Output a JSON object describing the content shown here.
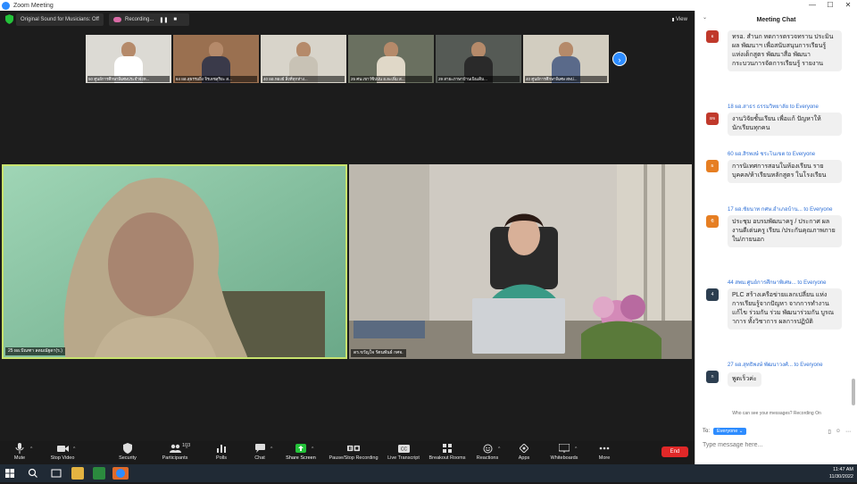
{
  "window": {
    "title": "Zoom Meeting",
    "controls": [
      "—",
      "☐",
      "✕"
    ]
  },
  "topbar": {
    "sound_label": "Original Sound for Musicians: Off",
    "recording_label": "Recording...",
    "pause_glyph": "❚❚",
    "stop_glyph": "■",
    "view_label": "View"
  },
  "thumbnails": [
    {
      "name": "50 ศูนย์การศึกษาพิเศษประจำจังห...",
      "bg": "#dcdad4",
      "shirt": "#ffffff"
    },
    {
      "name": "64 ผอ.สุธรรมยิ่ง จิรเดชสุริยะ ส...",
      "bg": "#9a7050",
      "shirt": "#3a3a4a"
    },
    {
      "name": "40 ผอ.ทองย์ สิ่งที่ทุกห่าง...",
      "bg": "#d8d4ca",
      "shirt": "#c8c2b5"
    },
    {
      "name": "25 ศน.เขาว์ซิปปน อ.ละเพิ่ม ส...",
      "bg": "#6a7060",
      "shirt": "#e0d8c8"
    },
    {
      "name": "29 สายะภาษาบ้านเนินเดิม...",
      "bg": "#555a55",
      "shirt": "#2a2a2a"
    },
    {
      "name": "40 ศูนย์การศึกษาพิเศษ สพป...",
      "bg": "#d2cdc0",
      "shirt": "#5a6a8a"
    }
  ],
  "next_glyph": "›",
  "videos": {
    "left_label": "25 ผอ.ปัณฑา ลดมณัฐดา(ร.)",
    "right_label": "ดร.ขวัญใจ รัตนพันธ์ กศจ."
  },
  "toolbar": {
    "items": [
      {
        "key": "mute",
        "label": "Mute",
        "icon": "microphone-icon"
      },
      {
        "key": "video",
        "label": "Stop Video",
        "icon": "camera-icon"
      },
      {
        "key": "security",
        "label": "Security",
        "icon": "shield-icon"
      },
      {
        "key": "participants",
        "label": "Participants",
        "icon": "people-icon",
        "count": "103"
      },
      {
        "key": "polls",
        "label": "Polls",
        "icon": "bar-chart-icon"
      },
      {
        "key": "chat",
        "label": "Chat",
        "icon": "chat-bubble-icon"
      },
      {
        "key": "share",
        "label": "Share Screen",
        "icon": "share-arrow-icon"
      },
      {
        "key": "record",
        "label": "Pause/Stop Recording",
        "icon": "record-icon"
      },
      {
        "key": "transcript",
        "label": "Live Transcript",
        "icon": "cc-icon"
      },
      {
        "key": "breakout",
        "label": "Breakout Rooms",
        "icon": "grid-icon"
      },
      {
        "key": "reactions",
        "label": "Reactions",
        "icon": "smiley-icon"
      },
      {
        "key": "apps",
        "label": "Apps",
        "icon": "apps-icon"
      },
      {
        "key": "whiteboards",
        "label": "Whiteboards",
        "icon": "whiteboard-icon"
      },
      {
        "key": "more",
        "label": "More",
        "icon": "dots-icon"
      }
    ],
    "end_label": "End"
  },
  "colors": {
    "share_green": "#24c33a",
    "end_red": "#e02828",
    "zoom_blue": "#2d8cff",
    "speaker_border": "#c8e36e"
  },
  "chat": {
    "title": "Meeting Chat",
    "collapse_glyph": "⌄",
    "messages": [
      {
        "sender": "",
        "avatar": "อ",
        "avatar_color": "#c0392b",
        "text": "ทรอ. สำนก ทดการตรวจทราน ประมินผล พัฒนาฯ เพื่อสนับสนุนการเรียนรู้ แห่งเด็กสูตร พัฒนาสื่อ พัฒนา กระบวนการจัดการเรียนรู้ รายงาน"
      },
      {
        "sender": "18 ผอ.สาธร ธรรมวิทยาลัย to Everyone",
        "avatar": "ผจ",
        "avatar_color": "#c0392b",
        "text": "งานวิจัยชั้นเรียน เพื่อแก้ ปัญหาให้นักเรียนทุกคน"
      },
      {
        "sender": "60 ผอ.สิรพงษ์ ชระโนเขต to Everyone",
        "avatar": "ผ",
        "avatar_color": "#e67e22",
        "text": "การนิเทศการสอนในห้องเรียน รายบุคคล/ห้าเรียนหลักสูตร ในโรงเรียน"
      },
      {
        "sender": "17 ผอ.ชัยนาท กศษ.อำเภอบ้าน... to Everyone",
        "avatar": "ขิ",
        "avatar_color": "#e67e22",
        "text": "ประชุม อบรมพัฒนาครู / ประกาศ ผลงานดีเด่นครู เรียน /ประกันคุณภาพภาย ใน/ภายนอก"
      },
      {
        "sender": "44 สพม.ศูนย์การศึกษาพิเศษ... to Everyone",
        "avatar": "4",
        "avatar_color": "#2c3e50",
        "text": "PLC สร้างเครือข่ายแลกเปลี่ยน แห่งการเรียนรู้จากปัญหา จากการทำงาน แก้ไข ร่วมกัน ร่วม พัฒนาร่วมกัน บูรณาการ ทั้งวิชาการ ผลการปฏิบัติ"
      },
      {
        "sender": "27 ผอ.สุทธิพงษ์ พัฒนาวงศ์... to Everyone",
        "avatar": "ก",
        "avatar_color": "#2c3e50",
        "text": "พูดเร็วค่ะ"
      }
    ],
    "who_label": "Who can see your messages? Recording On",
    "to_label": "To:",
    "everyone_label": "Everyone ⌄",
    "input_placeholder": "Type message here..."
  },
  "taskbar": {
    "time": "11:47 AM",
    "date": "11/30/2022"
  }
}
